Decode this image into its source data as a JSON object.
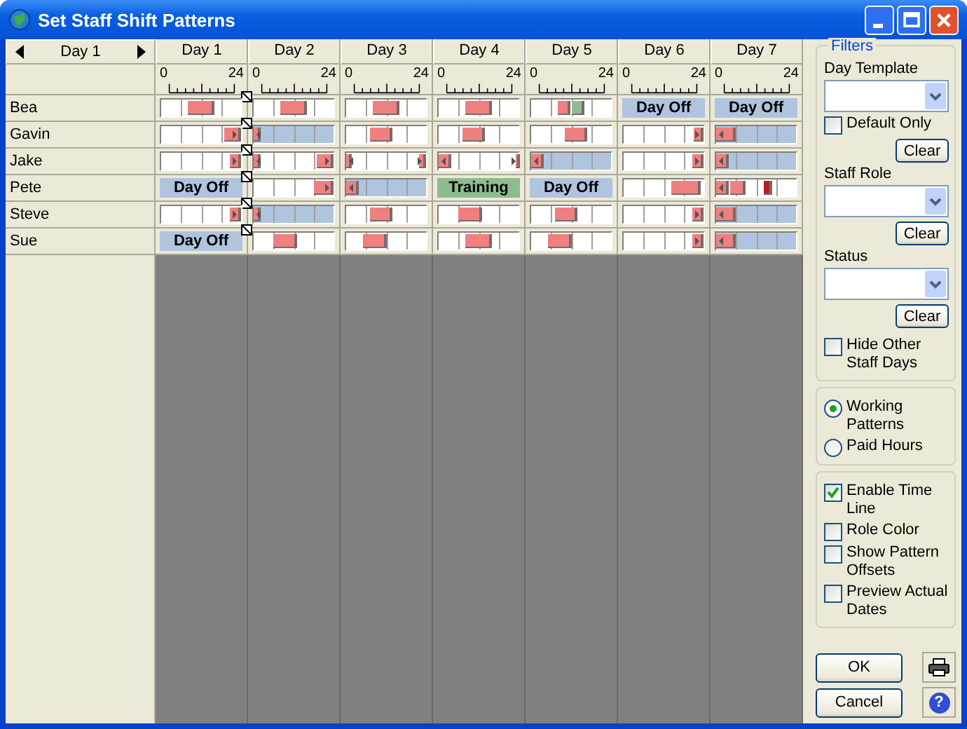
{
  "window": {
    "title": "Set Staff Shift Patterns"
  },
  "day_picker": {
    "label": "Day 1"
  },
  "days": [
    {
      "label": "Day 1",
      "scale_start": "0",
      "scale_end": "24"
    },
    {
      "label": "Day 2",
      "scale_start": "0",
      "scale_end": "24"
    },
    {
      "label": "Day 3",
      "scale_start": "0",
      "scale_end": "24"
    },
    {
      "label": "Day 4",
      "scale_start": "0",
      "scale_end": "24"
    },
    {
      "label": "Day 5",
      "scale_start": "0",
      "scale_end": "24"
    },
    {
      "label": "Day 6",
      "scale_start": "0",
      "scale_end": "24"
    },
    {
      "label": "Day 7",
      "scale_start": "0",
      "scale_end": "24"
    }
  ],
  "staff": [
    {
      "name": "Bea",
      "marker": true,
      "days": [
        {
          "kind": "timeline",
          "shaded": false,
          "shifts": [
            {
              "kind": "standard",
              "color": "#f08080"
            }
          ]
        },
        {
          "kind": "timeline",
          "shaded": false,
          "shifts": [
            {
              "kind": "standard",
              "color": "#f08080"
            }
          ]
        },
        {
          "kind": "timeline",
          "shaded": false,
          "shifts": [
            {
              "kind": "standard",
              "color": "#f08080"
            }
          ]
        },
        {
          "kind": "timeline",
          "shaded": false,
          "shifts": [
            {
              "kind": "standard",
              "color": "#f08080"
            }
          ]
        },
        {
          "kind": "timeline",
          "shaded": false,
          "shifts": [
            {
              "kind": "splitfirst",
              "color": "#f08080"
            },
            {
              "kind": "splitsecond",
              "color": "#8fbc8f"
            }
          ]
        },
        {
          "kind": "label",
          "text": "Day Off",
          "color": "#b0c4de"
        },
        {
          "kind": "label",
          "text": "Day Off",
          "color": "#b0c4de"
        }
      ]
    },
    {
      "name": "Gavin",
      "marker": true,
      "days": [
        {
          "kind": "timeline",
          "shaded": false,
          "shifts": [
            {
              "kind": "evening",
              "color": "#f08080"
            }
          ]
        },
        {
          "kind": "timeline",
          "shaded": true,
          "shifts": [
            {
              "kind": "short",
              "color": "#f08080"
            }
          ]
        },
        {
          "kind": "timeline",
          "shaded": false,
          "shifts": [
            {
              "kind": "day",
              "color": "#f08080"
            }
          ]
        },
        {
          "kind": "timeline",
          "shaded": false,
          "shifts": [
            {
              "kind": "day",
              "color": "#f08080"
            }
          ]
        },
        {
          "kind": "timeline",
          "shaded": false,
          "shifts": [
            {
              "kind": "late",
              "color": "#f08080"
            }
          ]
        },
        {
          "kind": "timeline",
          "shaded": false,
          "shifts": [
            {
              "kind": "night",
              "color": "#f08080"
            }
          ]
        },
        {
          "kind": "timeline",
          "shaded": true,
          "shifts": [
            {
              "kind": "long",
              "color": "#f08080"
            }
          ]
        }
      ]
    },
    {
      "name": "Jake",
      "marker": true,
      "days": [
        {
          "kind": "timeline",
          "shaded": false,
          "shifts": [
            {
              "kind": "lateevening",
              "color": "#f08080"
            }
          ]
        },
        {
          "kind": "timeline",
          "shaded": false,
          "shifts": [
            {
              "kind": "short",
              "color": "#f08080"
            },
            {
              "kind": "evening",
              "color": "#f08080"
            }
          ]
        },
        {
          "kind": "timeline",
          "shaded": false,
          "shifts": [
            {
              "kind": "tiny",
              "color": "#f08080"
            },
            {
              "kind": "latenight",
              "color": "#f08080"
            }
          ]
        },
        {
          "kind": "timeline",
          "shaded": false,
          "shifts": [
            {
              "kind": "medium",
              "color": "#f08080"
            },
            {
              "kind": "midnight",
              "color": "#f08080"
            }
          ]
        },
        {
          "kind": "timeline",
          "shaded": true,
          "shifts": [
            {
              "kind": "medium",
              "color": "#f08080"
            }
          ]
        },
        {
          "kind": "timeline",
          "shaded": false,
          "shifts": [
            {
              "kind": "lateevening",
              "color": "#f08080"
            }
          ]
        },
        {
          "kind": "timeline",
          "shaded": true,
          "shifts": [
            {
              "kind": "medium",
              "color": "#f08080"
            }
          ]
        }
      ]
    },
    {
      "name": "Pete",
      "marker": true,
      "days": [
        {
          "kind": "label",
          "text": "Day Off",
          "color": "#b0c4de"
        },
        {
          "kind": "timeline",
          "shaded": false,
          "shifts": [
            {
              "kind": "earlyevening",
              "color": "#f08080"
            }
          ]
        },
        {
          "kind": "timeline",
          "shaded": true,
          "shifts": [
            {
              "kind": "medium",
              "color": "#f08080"
            }
          ]
        },
        {
          "kind": "label",
          "text": "Training",
          "color": "#8fbc8f"
        },
        {
          "kind": "label",
          "text": "Day Off",
          "color": "#b0c4de"
        },
        {
          "kind": "timeline",
          "shaded": false,
          "shifts": [
            {
              "kind": "swing",
              "color": "#f08080"
            }
          ]
        },
        {
          "kind": "timeline",
          "shaded": false,
          "shifts": [
            {
              "kind": "medium",
              "color": "#f08080"
            },
            {
              "kind": "dawn",
              "color": "#f08080"
            },
            {
              "kind": "brief",
              "color": "#b22222"
            }
          ]
        }
      ]
    },
    {
      "name": "Steve",
      "marker": true,
      "days": [
        {
          "kind": "timeline",
          "shaded": false,
          "shifts": [
            {
              "kind": "lateevening",
              "color": "#f08080"
            }
          ]
        },
        {
          "kind": "timeline",
          "shaded": true,
          "shifts": [
            {
              "kind": "short",
              "color": "#f08080"
            }
          ]
        },
        {
          "kind": "timeline",
          "shaded": false,
          "shifts": [
            {
              "kind": "day",
              "color": "#f08080"
            }
          ]
        },
        {
          "kind": "timeline",
          "shaded": false,
          "shifts": [
            {
              "kind": "morning",
              "color": "#f08080"
            }
          ]
        },
        {
          "kind": "timeline",
          "shaded": false,
          "shifts": [
            {
              "kind": "day",
              "color": "#f08080"
            }
          ]
        },
        {
          "kind": "timeline",
          "shaded": false,
          "shifts": [
            {
              "kind": "lateevening",
              "color": "#f08080"
            }
          ]
        },
        {
          "kind": "timeline",
          "shaded": true,
          "shifts": [
            {
              "kind": "long",
              "color": "#f08080"
            }
          ]
        }
      ]
    },
    {
      "name": "Sue",
      "marker": true,
      "days": [
        {
          "kind": "label",
          "text": "Day Off",
          "color": "#b0c4de"
        },
        {
          "kind": "timeline",
          "shaded": false,
          "shifts": [
            {
              "kind": "morning",
              "color": "#f08080"
            }
          ]
        },
        {
          "kind": "timeline",
          "shaded": false,
          "shifts": [
            {
              "kind": "early",
              "color": "#f08080"
            }
          ]
        },
        {
          "kind": "timeline",
          "shaded": false,
          "shifts": [
            {
              "kind": "standard",
              "color": "#f08080"
            }
          ]
        },
        {
          "kind": "timeline",
          "shaded": false,
          "shifts": [
            {
              "kind": "early",
              "color": "#f08080"
            }
          ]
        },
        {
          "kind": "timeline",
          "shaded": false,
          "shifts": [
            {
              "kind": "lateevening",
              "color": "#f08080"
            }
          ]
        },
        {
          "kind": "timeline",
          "shaded": true,
          "shifts": [
            {
              "kind": "long",
              "color": "#f08080"
            }
          ]
        }
      ]
    }
  ],
  "filters": {
    "title": "Filters",
    "groups": [
      {
        "label": "Day Template",
        "option": {
          "label": "Default Only",
          "checked": false
        },
        "button": "Clear"
      },
      {
        "label": "Staff Role",
        "button": "Clear"
      },
      {
        "label": "Status",
        "button": "Clear"
      }
    ],
    "hide_other": {
      "label": "Hide Other Staff Days",
      "checked": false
    }
  },
  "view_mode": [
    {
      "label": "Working Patterns",
      "selected": true
    },
    {
      "label": "Paid Hours",
      "selected": false
    }
  ],
  "options": [
    {
      "label": "Enable Time Line",
      "checked": true
    },
    {
      "label": "Role Color",
      "checked": false
    },
    {
      "label": "Show Pattern Offsets",
      "checked": false
    },
    {
      "label": "Preview Actual Dates",
      "checked": false
    }
  ],
  "buttons": [
    {
      "label": "OK"
    },
    {
      "label": "Cancel"
    }
  ],
  "help_button": {
    "glyph": "?"
  }
}
